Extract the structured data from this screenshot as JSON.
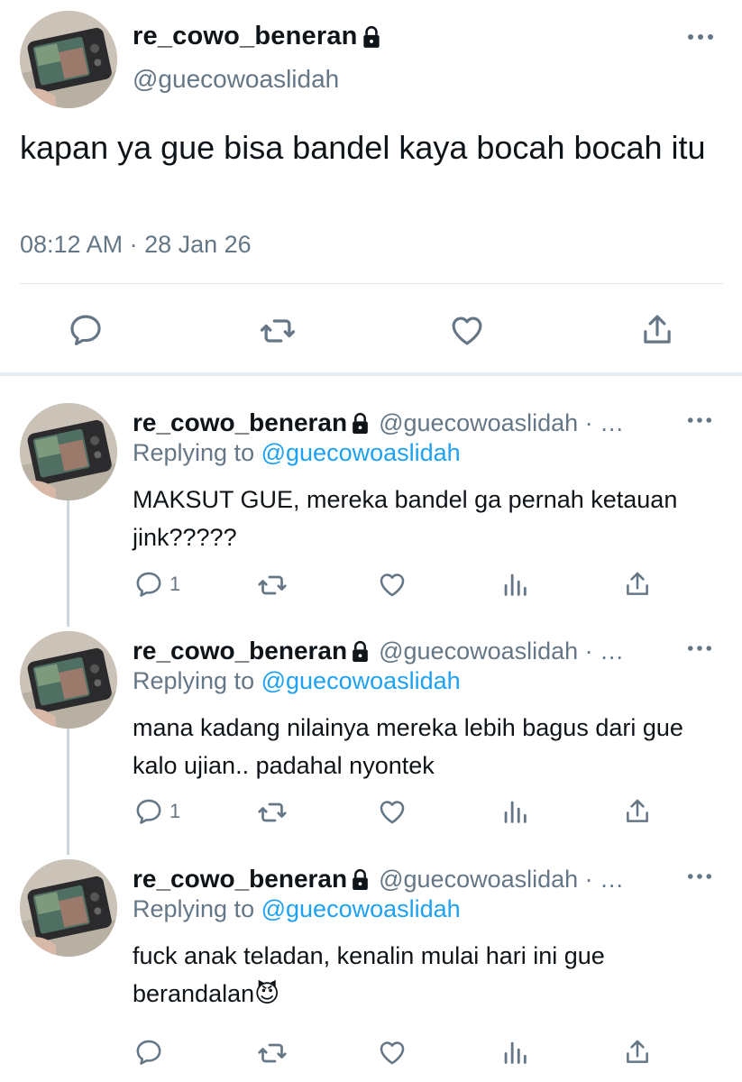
{
  "main_tweet": {
    "display_name": "re_cowo_beneran",
    "handle": "@guecowoaslidah",
    "text": "kapan ya gue bisa bandel kaya bocah bocah itu",
    "timestamp": "08:12 AM · 28 Jan 26",
    "protected_icon": "lock-icon",
    "actions": [
      "reply-icon",
      "retweet-icon",
      "like-icon",
      "share-icon"
    ]
  },
  "replies": [
    {
      "display_name": "re_cowo_beneran",
      "handle": "@guecowoaslidah · …",
      "replying_prefix": "Replying to",
      "replying_to": "@guecowoaslidah",
      "text": "MAKSUT GUE, mereka bandel ga pernah ketauan jink?????",
      "reply_count": "1"
    },
    {
      "display_name": "re_cowo_beneran",
      "handle": "@guecowoaslidah · …",
      "replying_prefix": "Replying to",
      "replying_to": "@guecowoaslidah",
      "text": "mana kadang nilainya mereka lebih bagus dari gue kalo ujian.. padahal nyontek",
      "reply_count": "1"
    },
    {
      "display_name": "re_cowo_beneran",
      "handle": "@guecowoaslidah · …",
      "replying_prefix": "Replying to",
      "replying_to": "@guecowoaslidah",
      "text": "fuck anak teladan, kenalin mulai hari ini gue berandalan😈",
      "reply_count": ""
    }
  ],
  "colors": {
    "secondary_text": "#657786",
    "link": "#1da1f2",
    "divider": "#e1e8ed",
    "thread_line": "#ccd6dd"
  }
}
